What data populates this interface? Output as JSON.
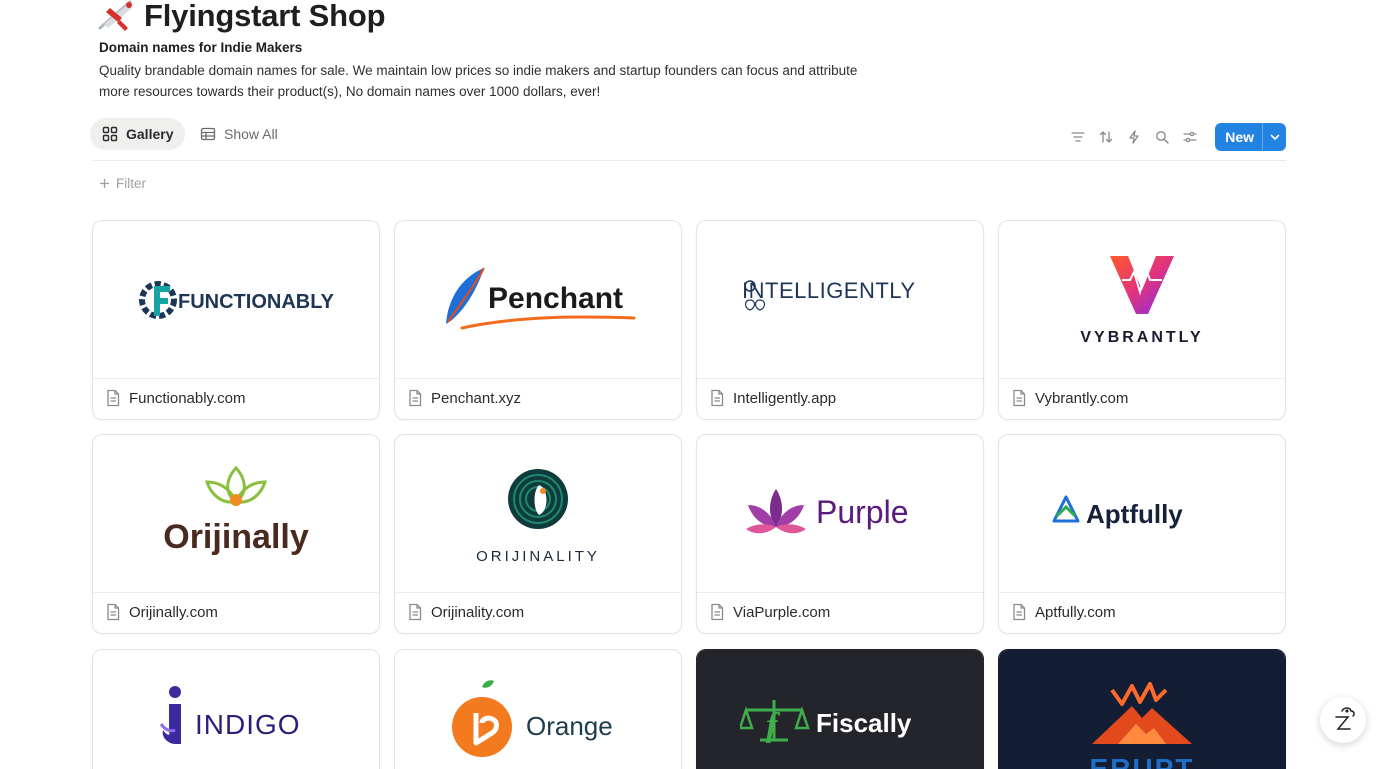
{
  "page": {
    "title": "Flyingstart Shop",
    "subtitle": "Domain names for Indie Makers",
    "description": "Quality brandable domain names for sale. We maintain low prices so indie makers and startup founders can focus and attribute more resources towards their product(s), No domain names over 1000 dollars, ever!"
  },
  "views": {
    "gallery_label": "Gallery",
    "show_all_label": "Show All"
  },
  "toolbar": {
    "new_label": "New",
    "icons": [
      "filter-icon",
      "sort-icon",
      "automation-icon",
      "search-icon",
      "settings-icon"
    ]
  },
  "filter": {
    "label": "Filter"
  },
  "colors": {
    "accent": "#2383e2",
    "text": "#37352f"
  },
  "cards": [
    {
      "name": "Functionably.com",
      "logo_text": "FUNCTIONABLY"
    },
    {
      "name": "Penchant.xyz",
      "logo_text": "Penchant"
    },
    {
      "name": "Intelligently.app",
      "logo_text": "INTELLIGENTLY"
    },
    {
      "name": "Vybrantly.com",
      "logo_text": "VYBRANTLY"
    },
    {
      "name": "Orijinally.com",
      "logo_text": "Orijinally"
    },
    {
      "name": "Orijinality.com",
      "logo_text": "ORIJINALITY"
    },
    {
      "name": "ViaPurple.com",
      "logo_text": "Purple"
    },
    {
      "name": "Aptfully.com",
      "logo_text": "Aptfully"
    },
    {
      "name": "",
      "logo_text": "INDIGO"
    },
    {
      "name": "",
      "logo_text": "Orange"
    },
    {
      "name": "",
      "logo_text": "Fiscally"
    },
    {
      "name": "",
      "logo_text": "ERUPT"
    }
  ]
}
